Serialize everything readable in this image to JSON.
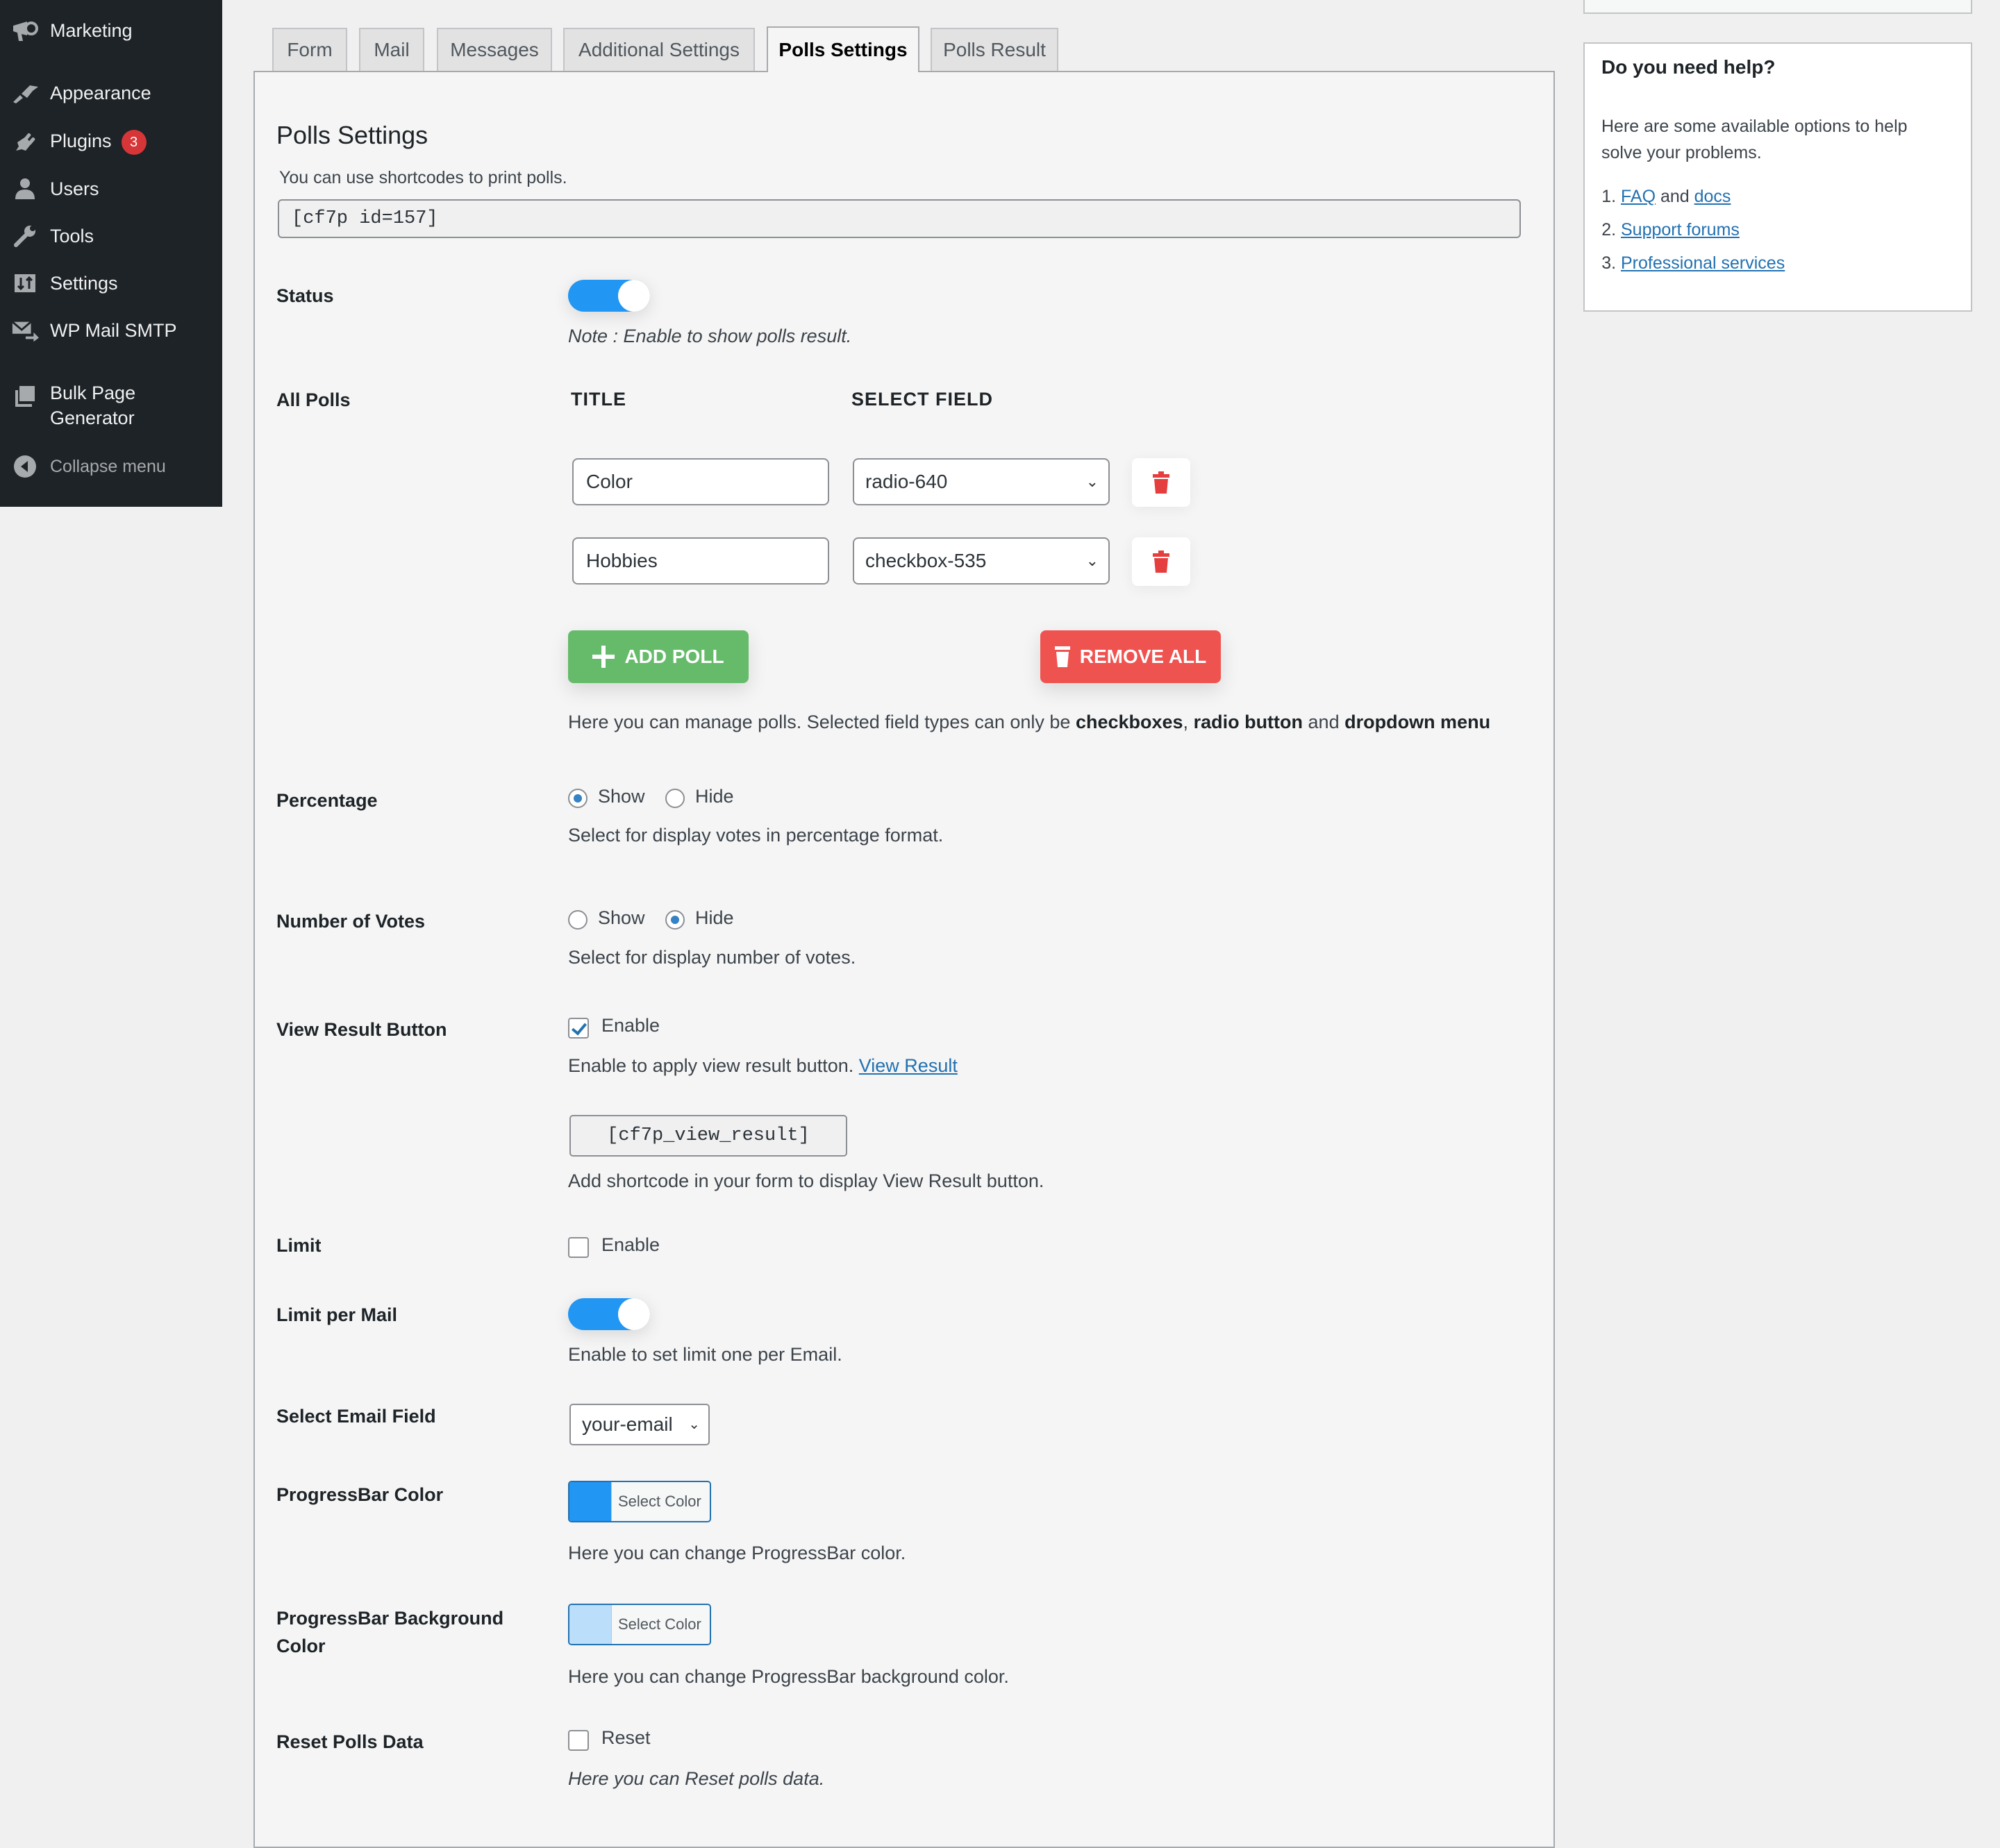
{
  "sidebar": {
    "items": [
      {
        "label": "Marketing",
        "icon": "megaphone-icon"
      },
      {
        "label": "Appearance",
        "icon": "paintbrush-icon"
      },
      {
        "label": "Plugins",
        "icon": "plugin-icon",
        "badge": "3"
      },
      {
        "label": "Users",
        "icon": "user-icon"
      },
      {
        "label": "Tools",
        "icon": "wrench-icon"
      },
      {
        "label": "Settings",
        "icon": "settings-icon"
      },
      {
        "label": "WP Mail SMTP",
        "icon": "mail-send-icon"
      },
      {
        "label": "Bulk Page Generator",
        "icon": "pages-icon"
      }
    ],
    "collapse_label": "Collapse menu"
  },
  "tabs": [
    {
      "label": "Form",
      "active": false
    },
    {
      "label": "Mail",
      "active": false
    },
    {
      "label": "Messages",
      "active": false
    },
    {
      "label": "Additional Settings",
      "active": false
    },
    {
      "label": "Polls Settings",
      "active": true
    },
    {
      "label": "Polls Result",
      "active": false
    }
  ],
  "main": {
    "title": "Polls Settings",
    "shortcode_hint": "You can use shortcodes to print polls.",
    "shortcode": "[cf7p id=157]",
    "status": {
      "label": "Status",
      "enabled": true,
      "note": "Note : Enable to show polls result."
    },
    "all_polls": {
      "label": "All Polls",
      "col_title": "TITLE",
      "col_field": "SELECT FIELD",
      "rows": [
        {
          "title": "Color",
          "field": "radio-640"
        },
        {
          "title": "Hobbies",
          "field": "checkbox-535"
        }
      ],
      "add_label": "ADD POLL",
      "remove_all_label": "REMOVE ALL",
      "help_prefix": "Here you can manage polls. Selected field types can only be ",
      "help_b1": "checkboxes",
      "help_sep1": ", ",
      "help_b2": "radio button",
      "help_sep2": " and ",
      "help_b3": "dropdown menu"
    },
    "percentage": {
      "label": "Percentage",
      "options": [
        "Show",
        "Hide"
      ],
      "selected": "Show",
      "help": "Select for display votes in percentage format."
    },
    "num_votes": {
      "label": "Number of Votes",
      "options": [
        "Show",
        "Hide"
      ],
      "selected": "Hide",
      "help": "Select for display number of votes."
    },
    "view_result": {
      "label": "View Result Button",
      "checkbox_label": "Enable",
      "checked": true,
      "help": "Enable to apply view result button. ",
      "link": "View Result",
      "shortcode": "[cf7p_view_result]",
      "shortcode_help": "Add shortcode in your form to display View Result button."
    },
    "limit": {
      "label": "Limit",
      "checkbox_label": "Enable",
      "checked": false
    },
    "limit_per_mail": {
      "label": "Limit per Mail",
      "enabled": true,
      "help": "Enable to set limit one per Email."
    },
    "email_field": {
      "label": "Select Email Field",
      "value": "your-email"
    },
    "progress_color": {
      "label": "ProgressBar Color",
      "button": "Select Color",
      "color": "#2196f3",
      "help": "Here you can change ProgressBar color."
    },
    "progress_bg": {
      "label": "ProgressBar Background Color",
      "button": "Select Color",
      "color": "#bbdefb",
      "help": "Here you can change ProgressBar background color."
    },
    "reset": {
      "label": "Reset Polls Data",
      "checkbox_label": "Reset",
      "checked": false,
      "help": "Here you can Reset polls data."
    }
  },
  "help_box": {
    "title": "Do you need help?",
    "text": "Here are some available options to help solve your problems.",
    "item1_link1": "FAQ",
    "item1_and": " and ",
    "item1_link2": "docs",
    "item2": "Support forums",
    "item3": "Professional services"
  },
  "colors": {
    "accent": "#2271b1",
    "toggle": "#2196f3",
    "add": "#66bb6a",
    "remove": "#ef5350",
    "sidebar": "#1d2327",
    "badge": "#d63638"
  }
}
